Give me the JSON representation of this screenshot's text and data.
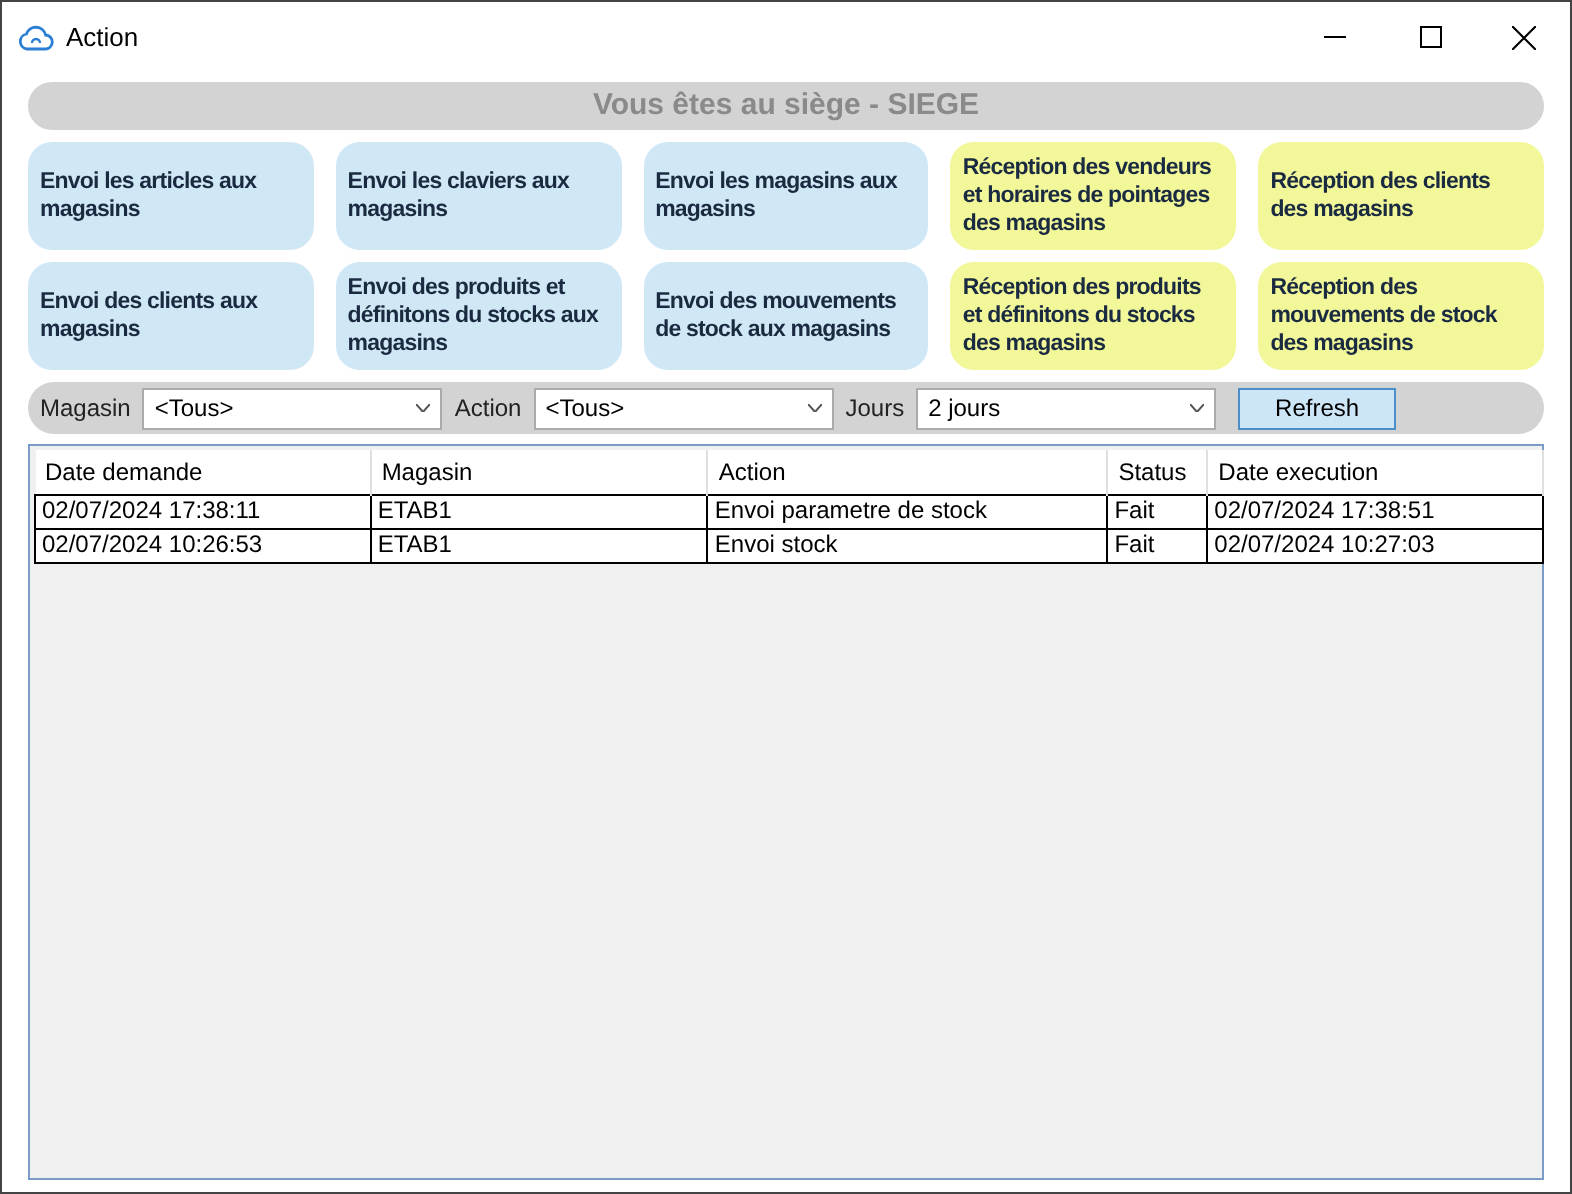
{
  "window": {
    "title": "Action"
  },
  "header": "Vous êtes au siège - SIEGE",
  "actions": [
    {
      "label": "Envoi les articles aux magasins",
      "kind": "send"
    },
    {
      "label": "Envoi les claviers aux magasins",
      "kind": "send"
    },
    {
      "label": "Envoi les magasins aux magasins",
      "kind": "send"
    },
    {
      "label": "Réception des vendeurs et horaires de pointages des magasins",
      "kind": "receive"
    },
    {
      "label": "Réception des clients des magasins",
      "kind": "receive"
    },
    {
      "label": "Envoi des clients aux magasins",
      "kind": "send"
    },
    {
      "label": "Envoi des produits et définitons du stocks aux magasins",
      "kind": "send"
    },
    {
      "label": "Envoi des mouvements de stock aux magasins",
      "kind": "send"
    },
    {
      "label": "Réception des produits et définitons du stocks des magasins",
      "kind": "receive"
    },
    {
      "label": "Réception des mouvements de stock des magasins",
      "kind": "receive"
    }
  ],
  "filters": [
    {
      "label": "Magasin",
      "value": "<Tous>"
    },
    {
      "label": "Action",
      "value": "<Tous>"
    },
    {
      "label": "Jours",
      "value": "2 jours"
    }
  ],
  "refresh_button": "Refresh",
  "table": {
    "columns": [
      "Date demande",
      "Magasin",
      "Action",
      "Status",
      "Date execution"
    ],
    "rows": [
      [
        "02/07/2024 17:38:11",
        "ETAB1",
        "Envoi parametre de stock",
        "Fait",
        "02/07/2024 17:38:51"
      ],
      [
        "02/07/2024 10:26:53",
        "ETAB1",
        "Envoi stock",
        "Fait",
        "02/07/2024 10:27:03"
      ]
    ]
  }
}
